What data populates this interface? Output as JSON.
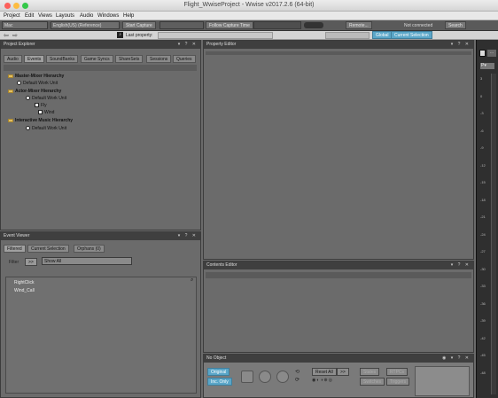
{
  "window": {
    "title": "Flight_WwiseProject - Wwise v2017.2.6 (64-bit)"
  },
  "menu": [
    "Project",
    "Edit",
    "Views",
    "Layouts",
    "Audio",
    "Windows",
    "Help"
  ],
  "toolbar": {
    "platform": "Mac",
    "language": "English(US) (Reference)",
    "start_capture": "Start Capture",
    "follow_capture_time": "Follow Capture Time",
    "remote": "Remote...",
    "connection": "Not connected",
    "search": "Search",
    "last_property": "Last property:",
    "global": "Global",
    "current_selection": "Current Selection",
    "icons": [
      "back-arrow-icon",
      "forward-arrow-icon",
      "sound-icon",
      "chevron-down-icon"
    ]
  },
  "project_explorer": {
    "title": "Project Explorer",
    "controls": "▾ ? ✕",
    "tabs": [
      "Audio",
      "Events",
      "SoundBanks",
      "Game Syncs",
      "ShareSets",
      "Sessions",
      "Queries"
    ],
    "tree": [
      {
        "label": "Master-Mixer Hierarchy",
        "level": 0,
        "type": "folder",
        "bold": true
      },
      {
        "label": "Default Work Unit",
        "level": 1,
        "type": "wu",
        "bold": false
      },
      {
        "label": "Actor-Mixer Hierarchy",
        "level": 0,
        "type": "folder",
        "bold": true
      },
      {
        "label": "Default Work Unit",
        "level": 1,
        "type": "wu",
        "bold": false
      },
      {
        "label": "Fly",
        "level": 2,
        "type": "sound",
        "bold": false
      },
      {
        "label": "Wind",
        "level": 2,
        "type": "sound",
        "bold": false
      },
      {
        "label": "Interactive Music Hierarchy",
        "level": 0,
        "type": "folder",
        "bold": true
      },
      {
        "label": "Default Work Unit",
        "level": 1,
        "type": "wu",
        "bold": false
      }
    ]
  },
  "event_viewer": {
    "title": "Event Viewer",
    "controls": "▾ ? ✕",
    "tabs": [
      "Filtered",
      "Current Selection",
      "Orphans (0)"
    ],
    "filter_label": "Filter",
    ">>": ">>",
    "filter_value": "Show All",
    "events": [
      "RightClick",
      "Wind_Call"
    ]
  },
  "property_editor": {
    "title": "Property Editor",
    "controls": "▾ ? ✕"
  },
  "contents_editor": {
    "title": "Contents Editor",
    "controls": "▾ ? ✕"
  },
  "transport": {
    "title": "No Object",
    "controls": "◉ ▾ ? ✕",
    "original": "Original",
    "inc_only": "Inc. Only",
    "reset_all": "Reset All",
    "more": ">>",
    "states": "States",
    "rtpcs": "RTPCs",
    "switches": "Switches",
    "triggers": "Triggers"
  },
  "meter": {
    "ticks": [
      "3",
      "0",
      "-3",
      "-6",
      "-9",
      "-12",
      "-15",
      "-18",
      "-21",
      "-24",
      "-27",
      "-30",
      "-33",
      "-36",
      "-39",
      "-42",
      "-45",
      "-48"
    ]
  }
}
